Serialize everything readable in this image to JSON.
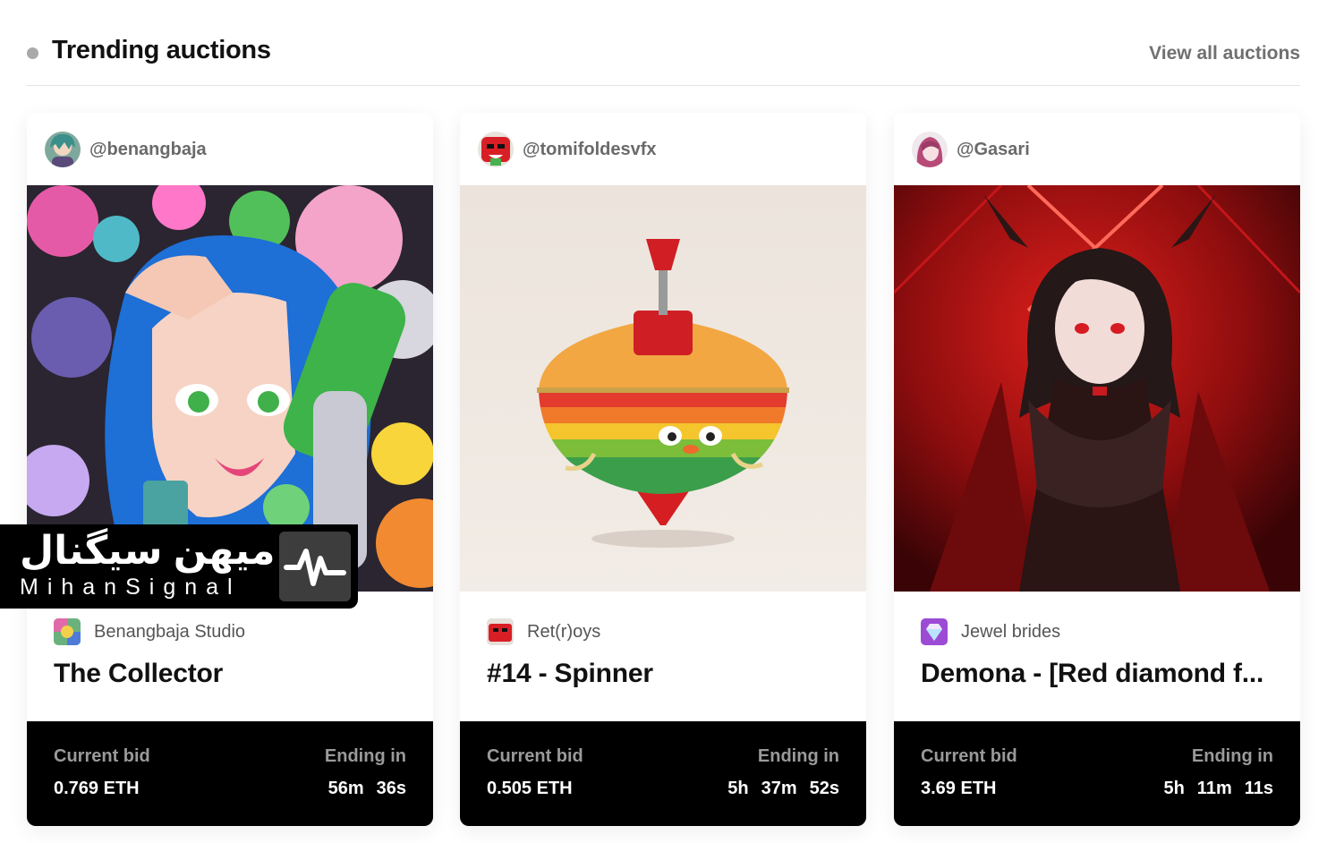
{
  "section": {
    "title": "Trending auctions",
    "view_all": "View all auctions"
  },
  "cards": [
    {
      "creator": "@benangbaja",
      "collection": "Benangbaja Studio",
      "title": "The Collector",
      "bid_label": "Current bid",
      "bid_value": "0.769 ETH",
      "ending_label": "Ending in",
      "time": [
        "56m",
        "36s"
      ]
    },
    {
      "creator": "@tomifoldesvfx",
      "collection": "Ret(r)oys",
      "title": "#14 - Spinner",
      "bid_label": "Current bid",
      "bid_value": "0.505 ETH",
      "ending_label": "Ending in",
      "time": [
        "5h",
        "37m",
        "52s"
      ]
    },
    {
      "creator": "@Gasari",
      "collection": "Jewel brides",
      "title": "Demona - [Red diamond f...",
      "bid_label": "Current bid",
      "bid_value": "3.69 ETH",
      "ending_label": "Ending in",
      "time": [
        "5h",
        "11m",
        "11s"
      ]
    }
  ],
  "watermark": {
    "persian": "میهن سیگنال",
    "latin": "MihanSignal",
    "logo_icon": "signal-pulse-icon"
  },
  "colors": {
    "accent_black": "#000000",
    "muted_text": "#6a6a6a",
    "label_gray": "#9a9a9a"
  }
}
